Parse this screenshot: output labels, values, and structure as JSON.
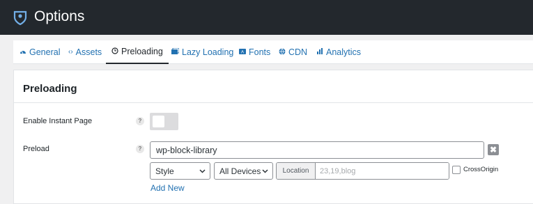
{
  "app": {
    "title": "Options",
    "logo_icon": "pin-shield-icon"
  },
  "tabs": [
    {
      "label": "General",
      "icon": "dashboard-icon",
      "active": false
    },
    {
      "label": "Assets",
      "icon": "code-icon",
      "active": false
    },
    {
      "label": "Preloading",
      "icon": "clock-icon",
      "active": true
    },
    {
      "label": "Lazy Loading",
      "icon": "images-icon",
      "active": false
    },
    {
      "label": "Fonts",
      "icon": "fonts-icon",
      "active": false
    },
    {
      "label": "CDN",
      "icon": "globe-icon",
      "active": false
    },
    {
      "label": "Analytics",
      "icon": "chart-bars-icon",
      "active": false
    }
  ],
  "section": {
    "title": "Preloading",
    "instant_page": {
      "label": "Enable Instant Page",
      "help": "?",
      "enabled": false
    },
    "preload": {
      "label": "Preload",
      "help": "?",
      "value": "wp-block-library",
      "remove_icon": "✖",
      "type_select": "Style",
      "device_select": "All Devices",
      "location_prefix": "Location",
      "location_placeholder": "23,19,blog",
      "crossorigin_label": "CrossOrigin",
      "crossorigin_checked": false,
      "add_new": "Add New"
    }
  },
  "colors": {
    "topbar": "#23282d",
    "link": "#2271b1",
    "text": "#1d2327"
  }
}
